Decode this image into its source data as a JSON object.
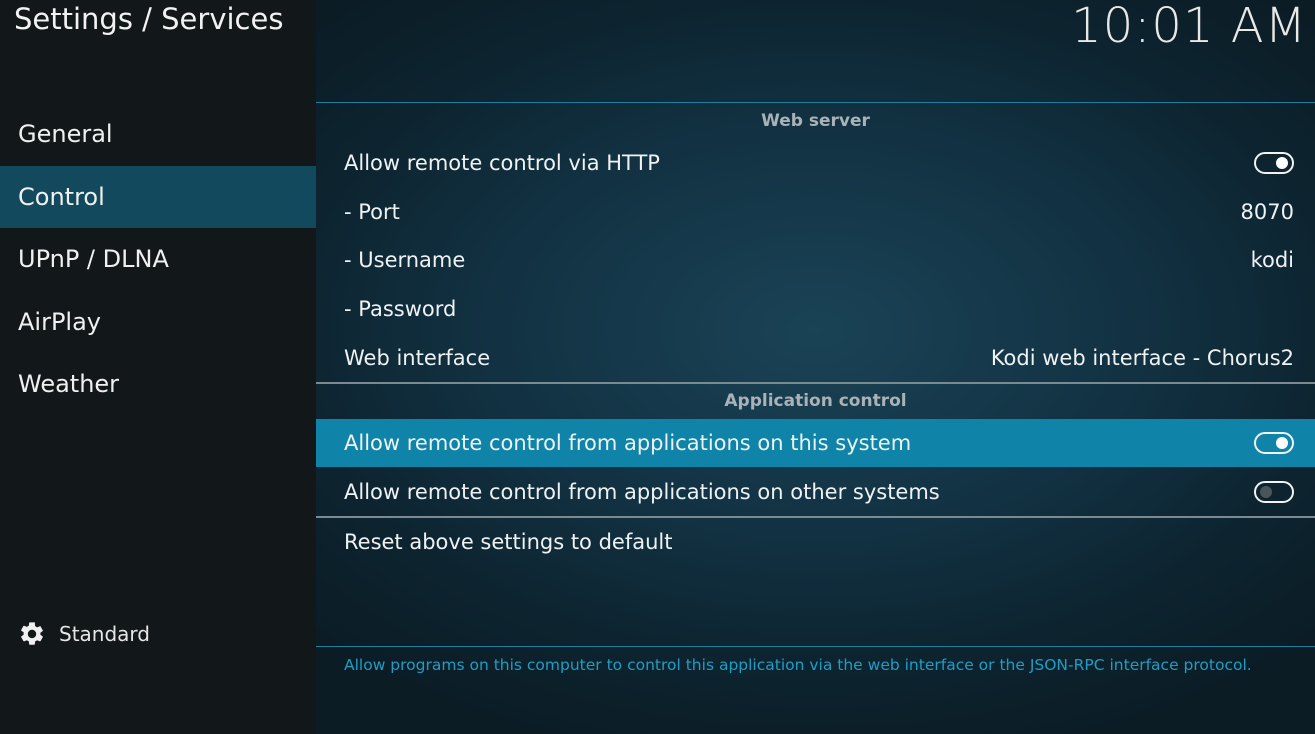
{
  "header": {
    "title": "Settings / Services",
    "clock": "10:01 AM"
  },
  "sidebar": {
    "items": [
      {
        "label": "General"
      },
      {
        "label": "Control"
      },
      {
        "label": "UPnP / DLNA"
      },
      {
        "label": "AirPlay"
      },
      {
        "label": "Weather"
      }
    ],
    "selected_index": 1,
    "settings_level": {
      "label": "Standard",
      "icon": "gear-icon"
    }
  },
  "sections": {
    "web_server": {
      "header": "Web server",
      "rows": {
        "http": {
          "label": "Allow remote control via HTTP",
          "state": "on"
        },
        "port": {
          "label": "- Port",
          "value": "8070"
        },
        "username": {
          "label": "- Username",
          "value": "kodi"
        },
        "password": {
          "label": "- Password",
          "value": ""
        },
        "web_interface": {
          "label": "Web interface",
          "value": "Kodi web interface - Chorus2"
        }
      }
    },
    "application_control": {
      "header": "Application control",
      "rows": {
        "this_system": {
          "label": "Allow remote control from applications on this system",
          "state": "on",
          "focused": true
        },
        "other_systems": {
          "label": "Allow remote control from applications on other systems",
          "state": "off"
        }
      }
    },
    "reset": {
      "label": "Reset above settings to default"
    }
  },
  "help_text": "Allow programs on this computer to control this application via the web interface or the JSON-RPC interface protocol.",
  "colors": {
    "accent": "#0f84a8",
    "sidebar_active": "#12495d",
    "help_text": "#1f9ec5"
  }
}
